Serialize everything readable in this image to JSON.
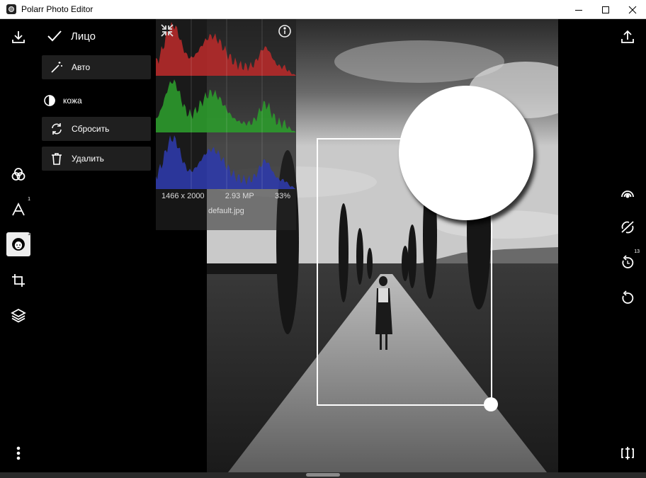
{
  "window": {
    "title": "Polarr Photo Editor",
    "controls": [
      "minimize-icon",
      "maximize-icon",
      "close-icon"
    ]
  },
  "left_toolbar": {
    "items": [
      {
        "name": "download-icon"
      },
      {
        "name": "filters-icon"
      },
      {
        "name": "text-icon",
        "badge": "1"
      },
      {
        "name": "face-icon",
        "badge": "1",
        "active": true
      },
      {
        "name": "crop-icon"
      },
      {
        "name": "layers-icon"
      },
      {
        "name": "more-vertical-icon"
      }
    ]
  },
  "face_panel": {
    "title": "Лицо",
    "auto_label": "Авто",
    "skin_label": "кожа",
    "reset_label": "Сбросить",
    "delete_label": "Удалить"
  },
  "histogram": {
    "resolution": "1466 x 2000",
    "megapixels": "2.93 MP",
    "zoom": "33%",
    "filename": "default.jpg",
    "colors": {
      "red": "#b52a2a",
      "green": "#2c9a2c",
      "blue": "#2d3aa8"
    }
  },
  "right_toolbar": {
    "items": [
      {
        "name": "export-icon"
      },
      {
        "name": "retouch-icon"
      },
      {
        "name": "hide-edits-icon"
      },
      {
        "name": "history-icon",
        "badge": "13"
      },
      {
        "name": "undo-icon"
      },
      {
        "name": "compare-icon"
      }
    ]
  }
}
